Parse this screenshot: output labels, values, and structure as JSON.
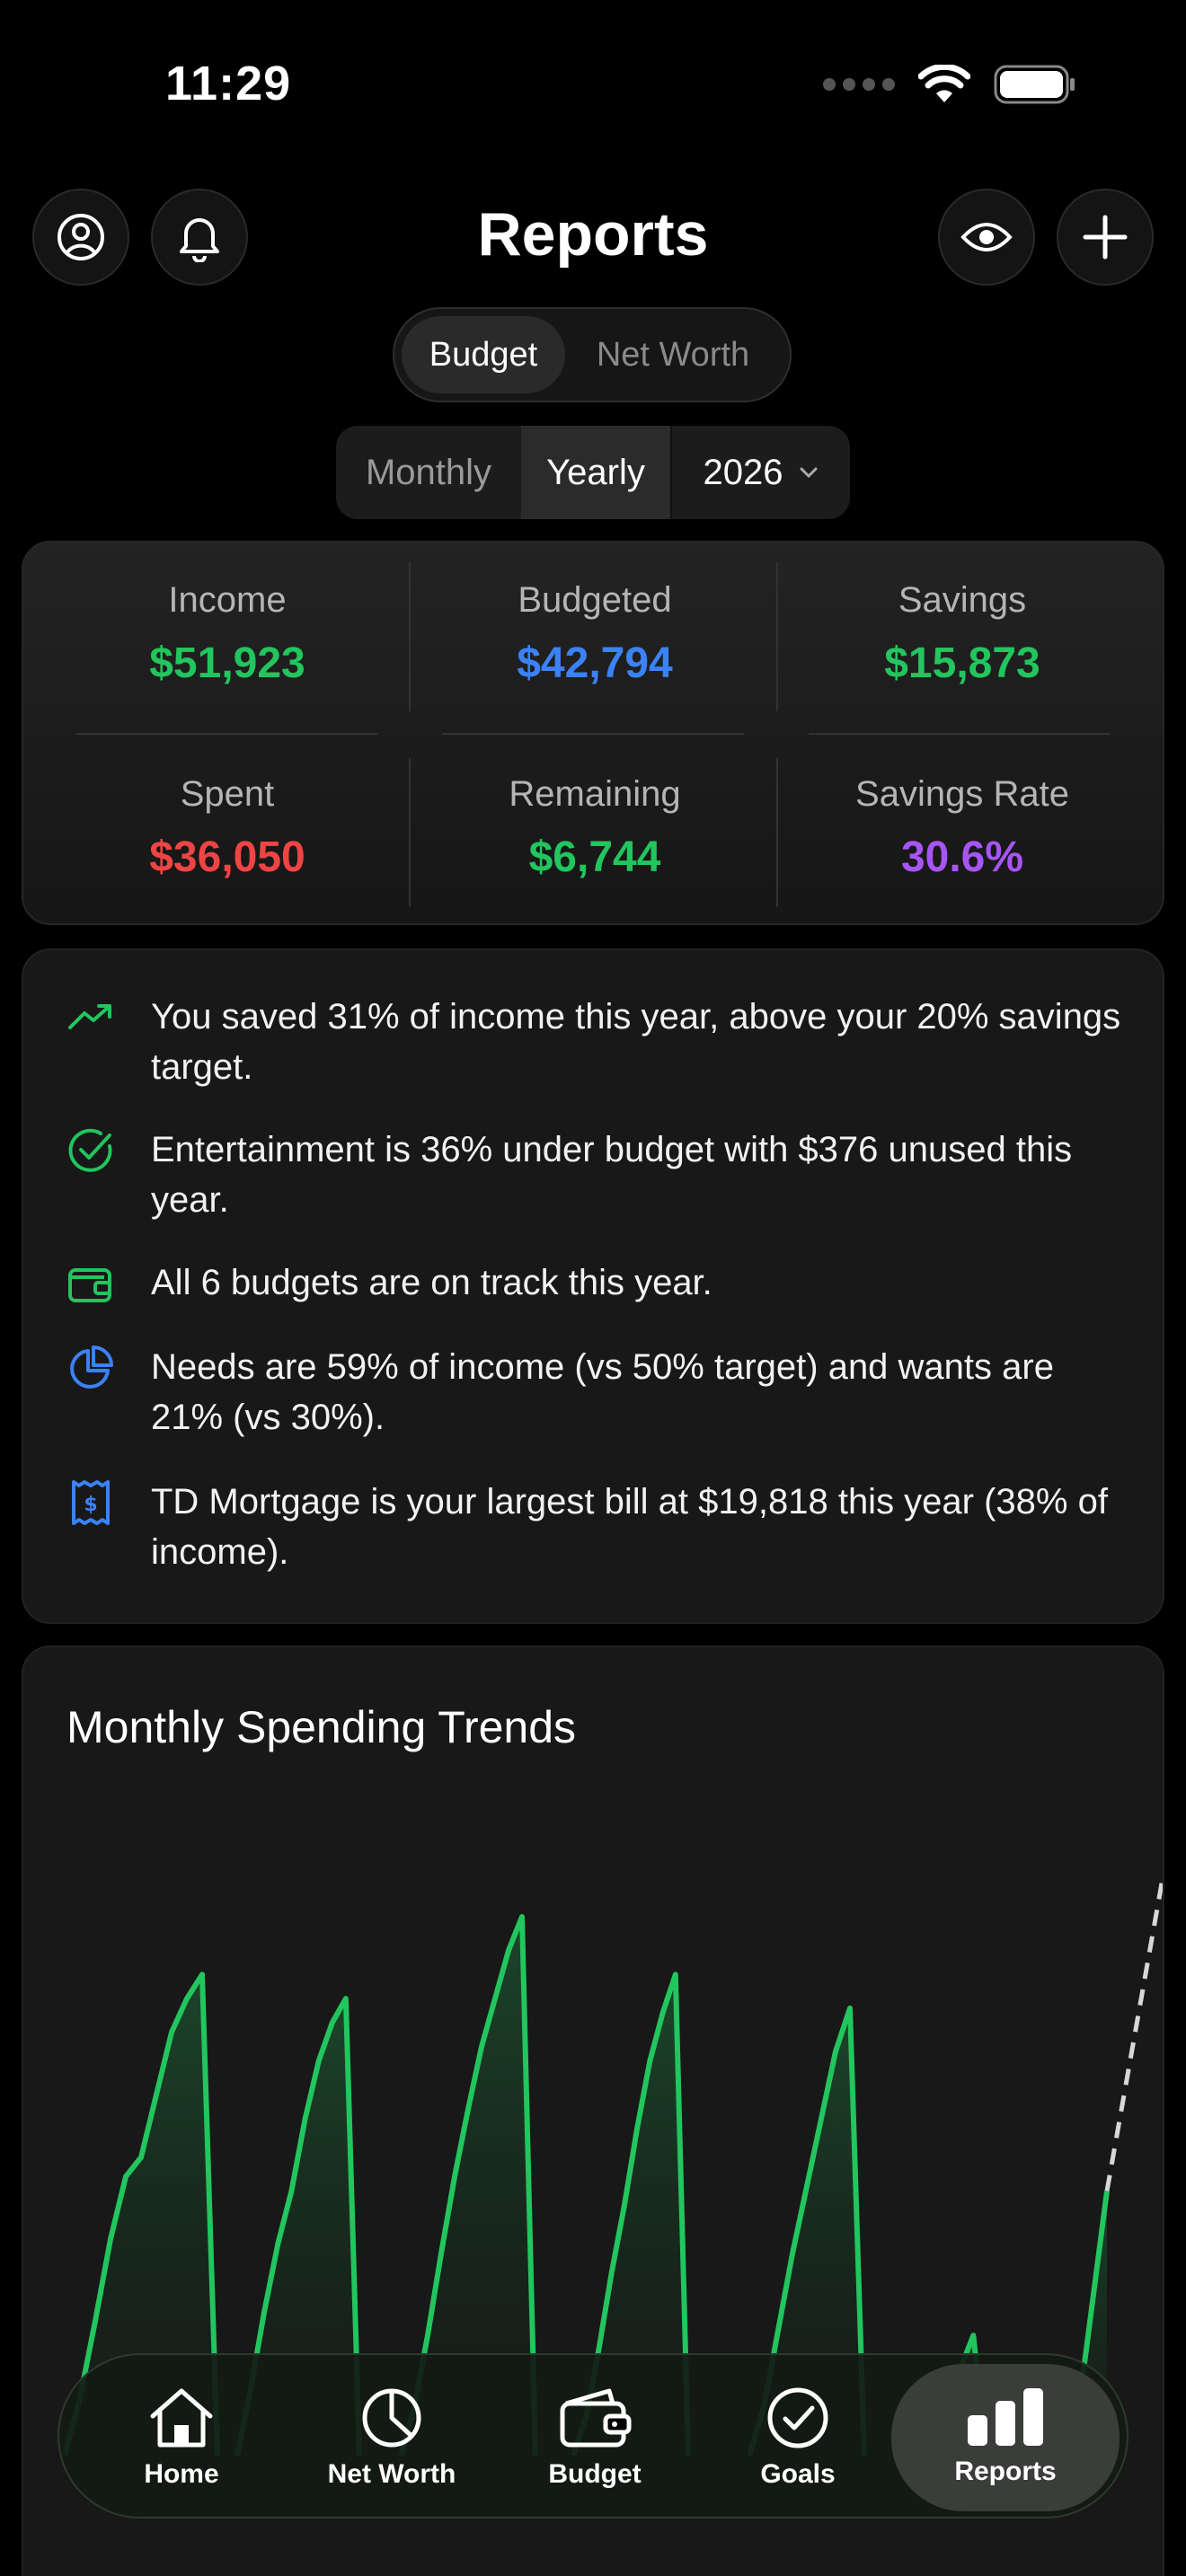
{
  "status": {
    "time": "11:29"
  },
  "header": {
    "title": "Reports"
  },
  "view_toggle": {
    "options": [
      "Budget",
      "Net Worth"
    ],
    "selected": "Budget"
  },
  "period": {
    "monthly": "Monthly",
    "yearly": "Yearly",
    "selected": "Yearly",
    "year": "2026"
  },
  "summary": {
    "income": {
      "label": "Income",
      "value": "$51,923"
    },
    "budgeted": {
      "label": "Budgeted",
      "value": "$42,794"
    },
    "savings": {
      "label": "Savings",
      "value": "$15,873"
    },
    "spent": {
      "label": "Spent",
      "value": "$36,050"
    },
    "remaining": {
      "label": "Remaining",
      "value": "$6,744"
    },
    "savings_rate": {
      "label": "Savings Rate",
      "value": "30.6%"
    }
  },
  "colors": {
    "green": "#22c55e",
    "blue": "#3b82f6",
    "red": "#ef4444",
    "purple": "#a855f7"
  },
  "insights": [
    {
      "icon": "trending-up-icon",
      "text": "You saved 31% of income this year, above your 20% savings target."
    },
    {
      "icon": "check-circle-icon",
      "text": "Entertainment is 36% under budget with $376 unused this year."
    },
    {
      "icon": "wallet-icon",
      "text": "All 6 budgets are on track this year."
    },
    {
      "icon": "pie-chart-icon",
      "text": "Needs are 59% of income (vs 50% target) and wants are 21% (vs 30%)."
    },
    {
      "icon": "receipt-icon",
      "text": "TD Mortgage is your largest bill at $19,818 this year (38% of income)."
    }
  ],
  "chart": {
    "title": "Monthly Spending Trends"
  },
  "chart_data": {
    "type": "area",
    "title": "Monthly Spending Trends",
    "series": [
      {
        "values": [
          0,
          0.12,
          0.28,
          0.45,
          0.58,
          0.62,
          0.75,
          0.88,
          0.95,
          1.0,
          0
        ]
      },
      {
        "values": [
          0,
          0.14,
          0.3,
          0.44,
          0.55,
          0.7,
          0.82,
          0.9,
          0.95,
          0
        ]
      },
      {
        "values": [
          0,
          0.1,
          0.25,
          0.42,
          0.58,
          0.72,
          0.85,
          0.95,
          1.05,
          1.12,
          0
        ]
      },
      {
        "values": [
          0,
          0.08,
          0.22,
          0.38,
          0.52,
          0.68,
          0.82,
          0.92,
          1.0,
          0
        ]
      },
      {
        "values": [
          0,
          0.1,
          0.26,
          0.42,
          0.56,
          0.7,
          0.84,
          0.93,
          0
        ]
      },
      {
        "values": [
          0,
          0.18,
          0.25,
          0
        ]
      },
      {
        "values": [
          0,
          0.12,
          0.55
        ]
      }
    ],
    "projection": {
      "from": 0.55,
      "to": 1.2
    }
  },
  "tabs": [
    {
      "label": "Home",
      "icon": "home-icon"
    },
    {
      "label": "Net Worth",
      "icon": "pie-chart-icon"
    },
    {
      "label": "Budget",
      "icon": "wallet-icon"
    },
    {
      "label": "Goals",
      "icon": "check-circle-icon"
    },
    {
      "label": "Reports",
      "icon": "bar-chart-icon",
      "active": true
    }
  ]
}
